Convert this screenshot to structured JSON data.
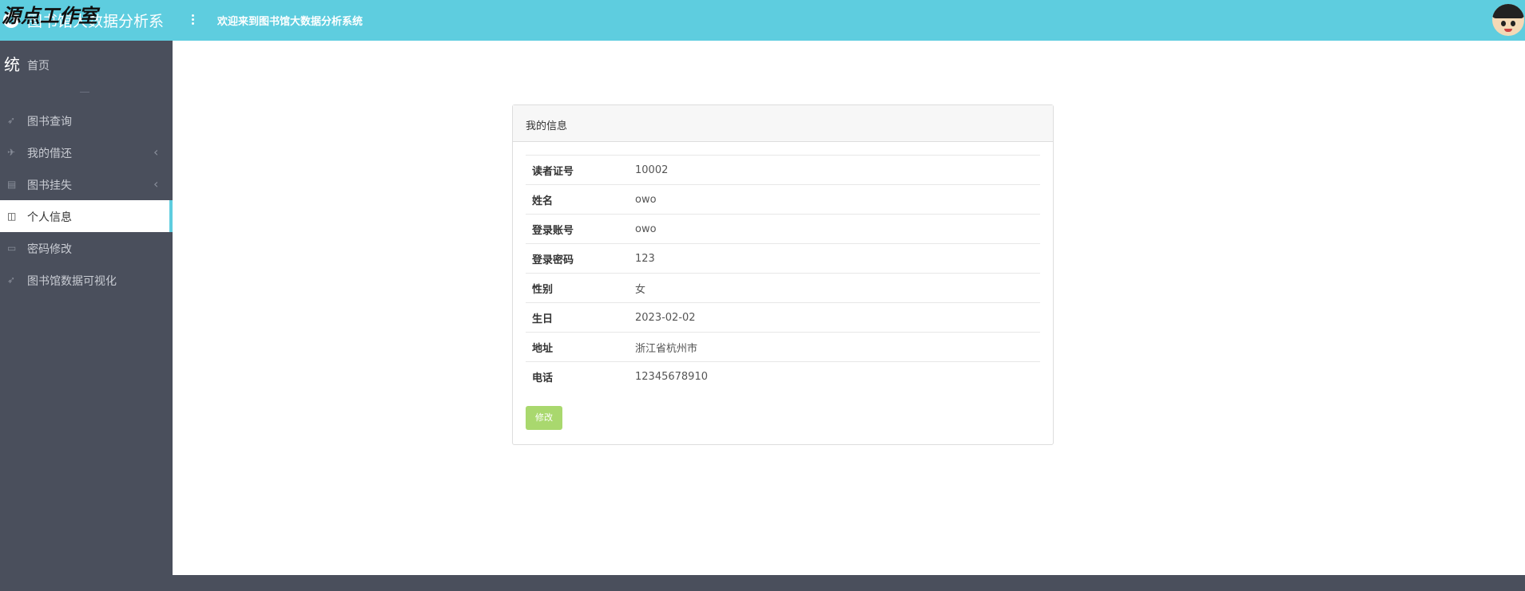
{
  "header": {
    "brand_title": "图书馆大数据分析系",
    "watermark": "源点工作室",
    "welcome": "欢迎来到图书馆大数据分析系统"
  },
  "sidebar": {
    "overflow_char": "统",
    "items": [
      {
        "label": "首页",
        "icon": "home-icon"
      },
      {
        "label": "图书查询",
        "icon": "rocket-icon"
      },
      {
        "label": "我的借还",
        "icon": "plane-icon",
        "has_submenu": true
      },
      {
        "label": "图书挂失",
        "icon": "copy-icon",
        "has_submenu": true
      },
      {
        "label": "个人信息",
        "icon": "gift-icon",
        "active": true
      },
      {
        "label": "密码修改",
        "icon": "inbox-icon"
      },
      {
        "label": "图书馆数据可视化",
        "icon": "rocket-icon"
      }
    ]
  },
  "main": {
    "panel_title": "我的信息",
    "rows": [
      {
        "key": "读者证号",
        "value": "10002"
      },
      {
        "key": "姓名",
        "value": "owo"
      },
      {
        "key": "登录账号",
        "value": "owo"
      },
      {
        "key": "登录密码",
        "value": "123"
      },
      {
        "key": "性别",
        "value": "女"
      },
      {
        "key": "生日",
        "value": "2023-02-02"
      },
      {
        "key": "地址",
        "value": "浙江省杭州市"
      },
      {
        "key": "电话",
        "value": "12345678910"
      }
    ],
    "edit_label": "修改"
  },
  "colors": {
    "topbar": "#5ecddf",
    "sidebar": "#4a4f5c",
    "button": "#a9d86e"
  }
}
